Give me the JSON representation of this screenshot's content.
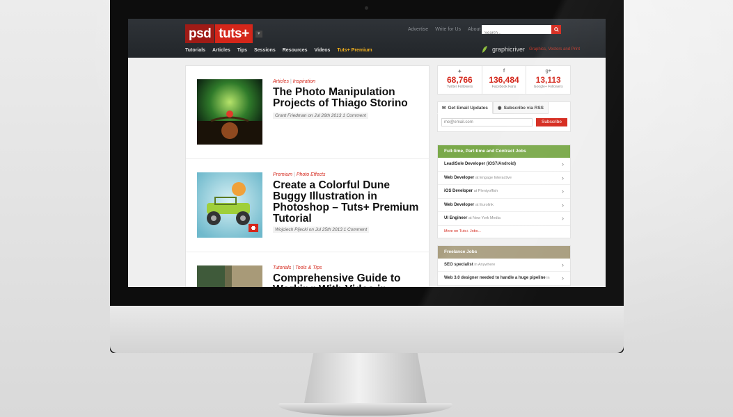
{
  "site": {
    "logo": {
      "part1": "psd",
      "part2": "tuts+"
    },
    "top_links": [
      "Advertise",
      "Write for Us",
      "About"
    ],
    "search_placeholder": "Search...",
    "nav": [
      "Tutorials",
      "Articles",
      "Tips",
      "Sessions",
      "Resources",
      "Videos",
      "Tuts+ Premium"
    ],
    "graphicriver": {
      "name": "graphicriver",
      "tagline": "Graphics, Vectors and Print"
    }
  },
  "articles": [
    {
      "cat1": "Articles",
      "cat2": "Inspiration",
      "title": "The Photo Manipulation Projects of Thiago Storino",
      "meta": "Grant Friedman on Jul 26th 2013 1 Comment"
    },
    {
      "cat1": "Premium",
      "cat2": "Photo Effects",
      "title": "Create a Colorful Dune Buggy Illustration in Photoshop – Tuts+ Premium Tutorial",
      "meta": "Wojciech Pijecki on Jul 25th 2013 1 Comment"
    },
    {
      "cat1": "Tutorials",
      "cat2": "Tools & Tips",
      "title": "Comprehensive Guide to Working With Video in"
    }
  ],
  "social": [
    {
      "icon": "twitter-icon",
      "count": "68,766",
      "label": "Twitter Followers"
    },
    {
      "icon": "facebook-icon",
      "count": "136,484",
      "label": "Facebook Fans"
    },
    {
      "icon": "googleplus-icon",
      "count": "13,113",
      "label": "Google+ Followers"
    }
  ],
  "email": {
    "tab1": "Get Email Updates",
    "tab2": "Subscribe via RSS",
    "placeholder": "me@email.com",
    "button": "Subscribe"
  },
  "jobs": {
    "heading": "Full-time, Part-time and Contract Jobs",
    "items": [
      {
        "title": "Lead/Sole Developer (iOS7/Android)",
        "at": ""
      },
      {
        "title": "Web Developer",
        "at": "at Engage Interactive"
      },
      {
        "title": "iOS Developer",
        "at": "at Plentyoffish"
      },
      {
        "title": "Web Developer",
        "at": "at Eurolink"
      },
      {
        "title": "UI Engineer",
        "at": "at New York Media"
      }
    ],
    "more": "More on Tuts+ Jobs..."
  },
  "freelance": {
    "heading": "Freelance Jobs",
    "items": [
      {
        "title": "SEO specialist",
        "at": "in Anywhere"
      },
      {
        "title": "Web 3.0 designer needed to handle a huge pipeline",
        "at": "in"
      }
    ]
  },
  "colors": {
    "brand_red": "#d4261a",
    "jobs_green": "#7aa94a",
    "freelance_tan": "#a99e80",
    "premium_gold": "#f2b01e"
  }
}
